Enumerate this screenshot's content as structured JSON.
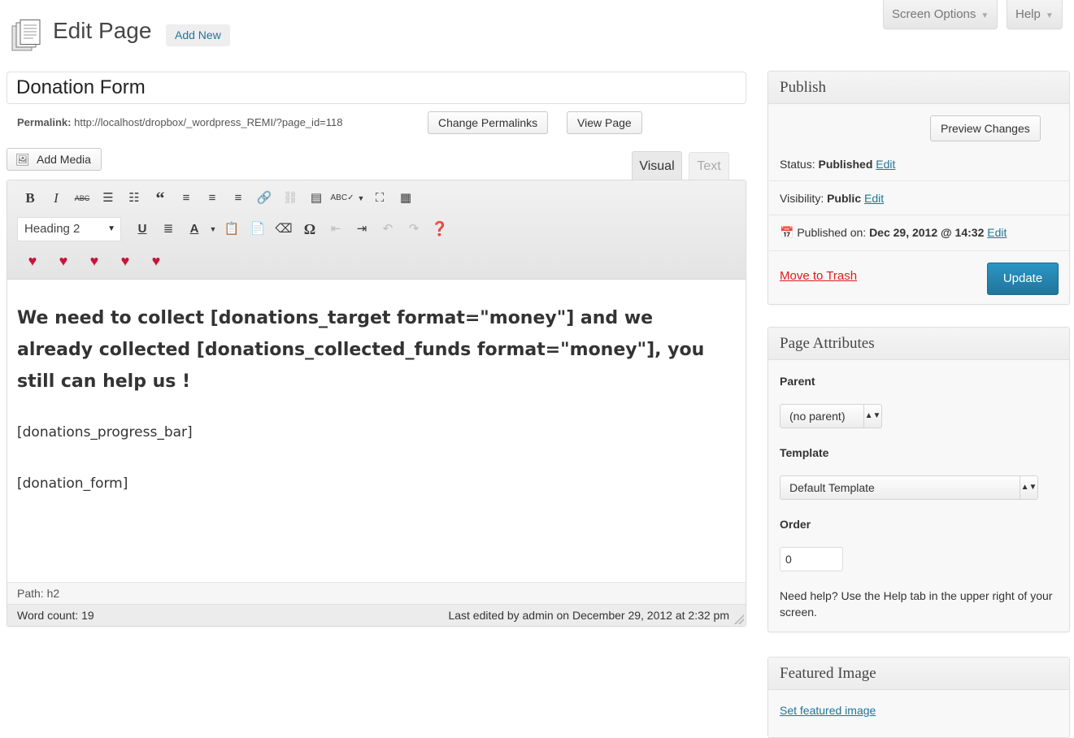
{
  "top_tabs": {
    "screen_options": "Screen Options",
    "help": "Help"
  },
  "header": {
    "title": "Edit Page",
    "add_new": "Add New"
  },
  "post": {
    "title": "Donation Form",
    "permalink_label": "Permalink:",
    "permalink_url": "http://localhost/dropbox/_wordpress_REMI/?page_id=118",
    "change_permalinks": "Change Permalinks",
    "view_page": "View Page"
  },
  "editor": {
    "add_media": "Add Media",
    "tab_visual": "Visual",
    "tab_text": "Text",
    "format_value": "Heading 2",
    "content_heading": "We need to collect [donations_target format=\"money\"] and we already collected [donations_collected_funds format=\"money\"], you still can help us !",
    "content_p1": "[donations_progress_bar]",
    "content_p2": "[donation_form]",
    "path": "Path: h2",
    "word_count": "Word count: 19",
    "last_edited": "Last edited by admin on December 29, 2012 at 2:32 pm"
  },
  "publish_box": {
    "title": "Publish",
    "preview_changes": "Preview Changes",
    "status_label": "Status:",
    "status_value": "Published",
    "visibility_label": "Visibility:",
    "visibility_value": "Public",
    "published_label": "Published on:",
    "published_value": "Dec 29, 2012 @ 14:32",
    "edit": "Edit",
    "move_to_trash": "Move to Trash",
    "update": "Update"
  },
  "page_attributes": {
    "title": "Page Attributes",
    "parent_label": "Parent",
    "parent_value": "(no parent)",
    "template_label": "Template",
    "template_value": "Default Template",
    "order_label": "Order",
    "order_value": "0",
    "help_text": "Need help? Use the Help tab in the upper right of your screen."
  },
  "featured_image": {
    "title": "Featured Image",
    "set_link": "Set featured image"
  },
  "colors": {
    "link": "#21759b",
    "update_button": "#21759b",
    "trash": "#e21c1c",
    "heart": "#c8143a"
  }
}
